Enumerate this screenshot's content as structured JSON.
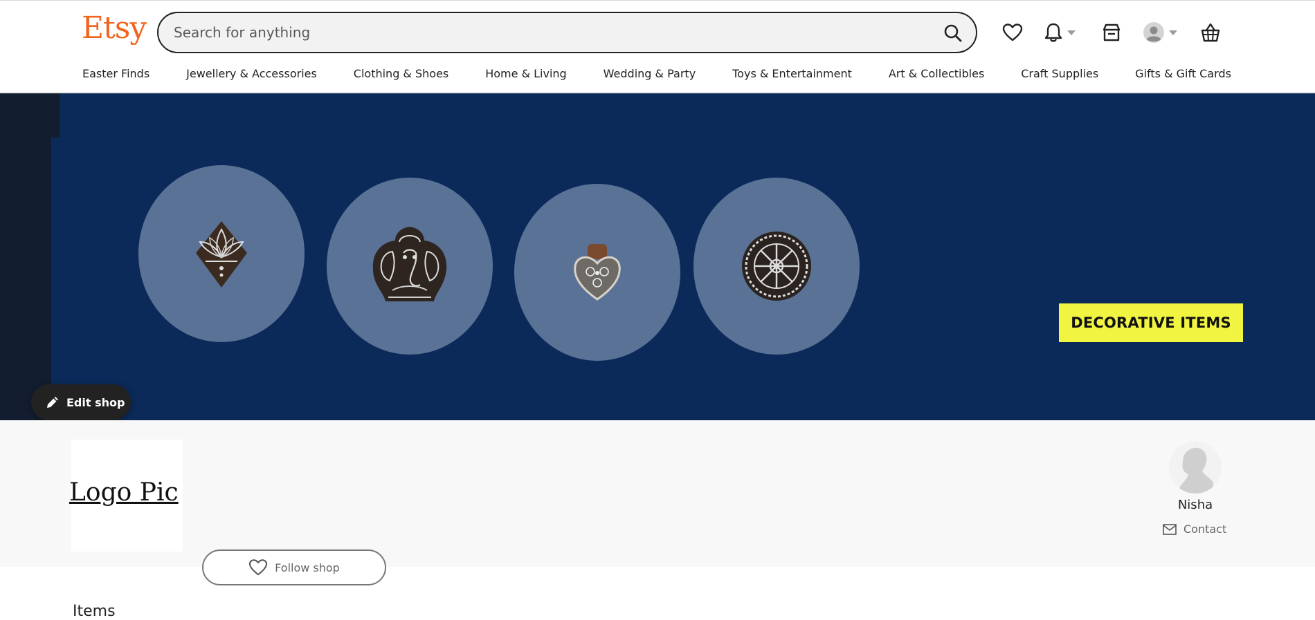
{
  "header": {
    "logo": "Etsy",
    "search_placeholder": "Search for anything",
    "icons": [
      "heart-icon",
      "bell-icon",
      "shop-manager-icon",
      "account-icon",
      "basket-icon"
    ]
  },
  "categories": [
    "Easter Finds",
    "Jewellery & Accessories",
    "Clothing & Shoes",
    "Home & Living",
    "Wedding & Party",
    "Toys & Entertainment",
    "Art & Collectibles",
    "Craft Supplies",
    "Gifts & Gift Cards"
  ],
  "banner": {
    "label": "DECORATIVE ITEMS",
    "items": [
      "lotus-stamp",
      "ganesha-stamp",
      "heart-stamp",
      "mandala-stamp"
    ],
    "edit_label": "Edit shop"
  },
  "shop": {
    "logo_text": "Logo Pic",
    "follow_label": "Follow shop",
    "owner_name": "Nisha",
    "contact_label": "Contact"
  },
  "items_heading": "Items",
  "colors": {
    "brand": "#f1641e",
    "banner_bg": "#0b2a5a",
    "label_bg": "#f1f542"
  }
}
